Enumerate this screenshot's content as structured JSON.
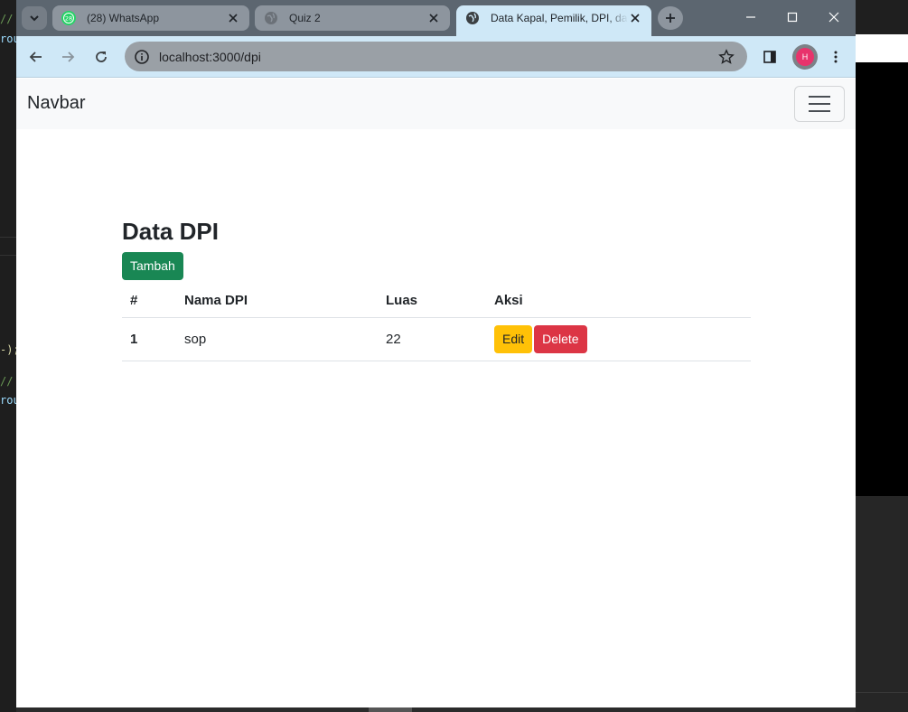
{
  "background_editor": {
    "lines": [
      {
        "text": "//",
        "color": "#6a9955"
      },
      {
        "text": "rou",
        "color": "#9cdcfe"
      },
      {
        "text": "-);",
        "color": "#dcdcaa"
      },
      {
        "text": "//",
        "color": "#6a9955"
      },
      {
        "text": "rou",
        "color": "#9cdcfe"
      }
    ]
  },
  "browser": {
    "tabs": [
      {
        "title": "(28) WhatsApp",
        "badge": "28",
        "icon": "whatsapp-icon",
        "active": false
      },
      {
        "title": "Quiz 2",
        "icon": "globe-icon",
        "active": false
      },
      {
        "title": "Data Kapal, Pemilik, DPI, dan Alat Tangkap",
        "icon": "globe-icon",
        "active": true
      }
    ],
    "url": "localhost:3000/dpi",
    "profile_initial": "H"
  },
  "navbar": {
    "brand": "Navbar"
  },
  "page": {
    "title": "Data DPI",
    "add_button": "Tambah",
    "table": {
      "headers": [
        "#",
        "Nama DPI",
        "Luas",
        "Aksi"
      ],
      "rows": [
        {
          "no": "1",
          "nama": "sop",
          "luas": "22",
          "edit": "Edit",
          "delete": "Delete"
        }
      ]
    }
  },
  "colors": {
    "success": "#198754",
    "warning": "#ffc107",
    "danger": "#dc3545",
    "active_tab": "#cfe8f7"
  }
}
